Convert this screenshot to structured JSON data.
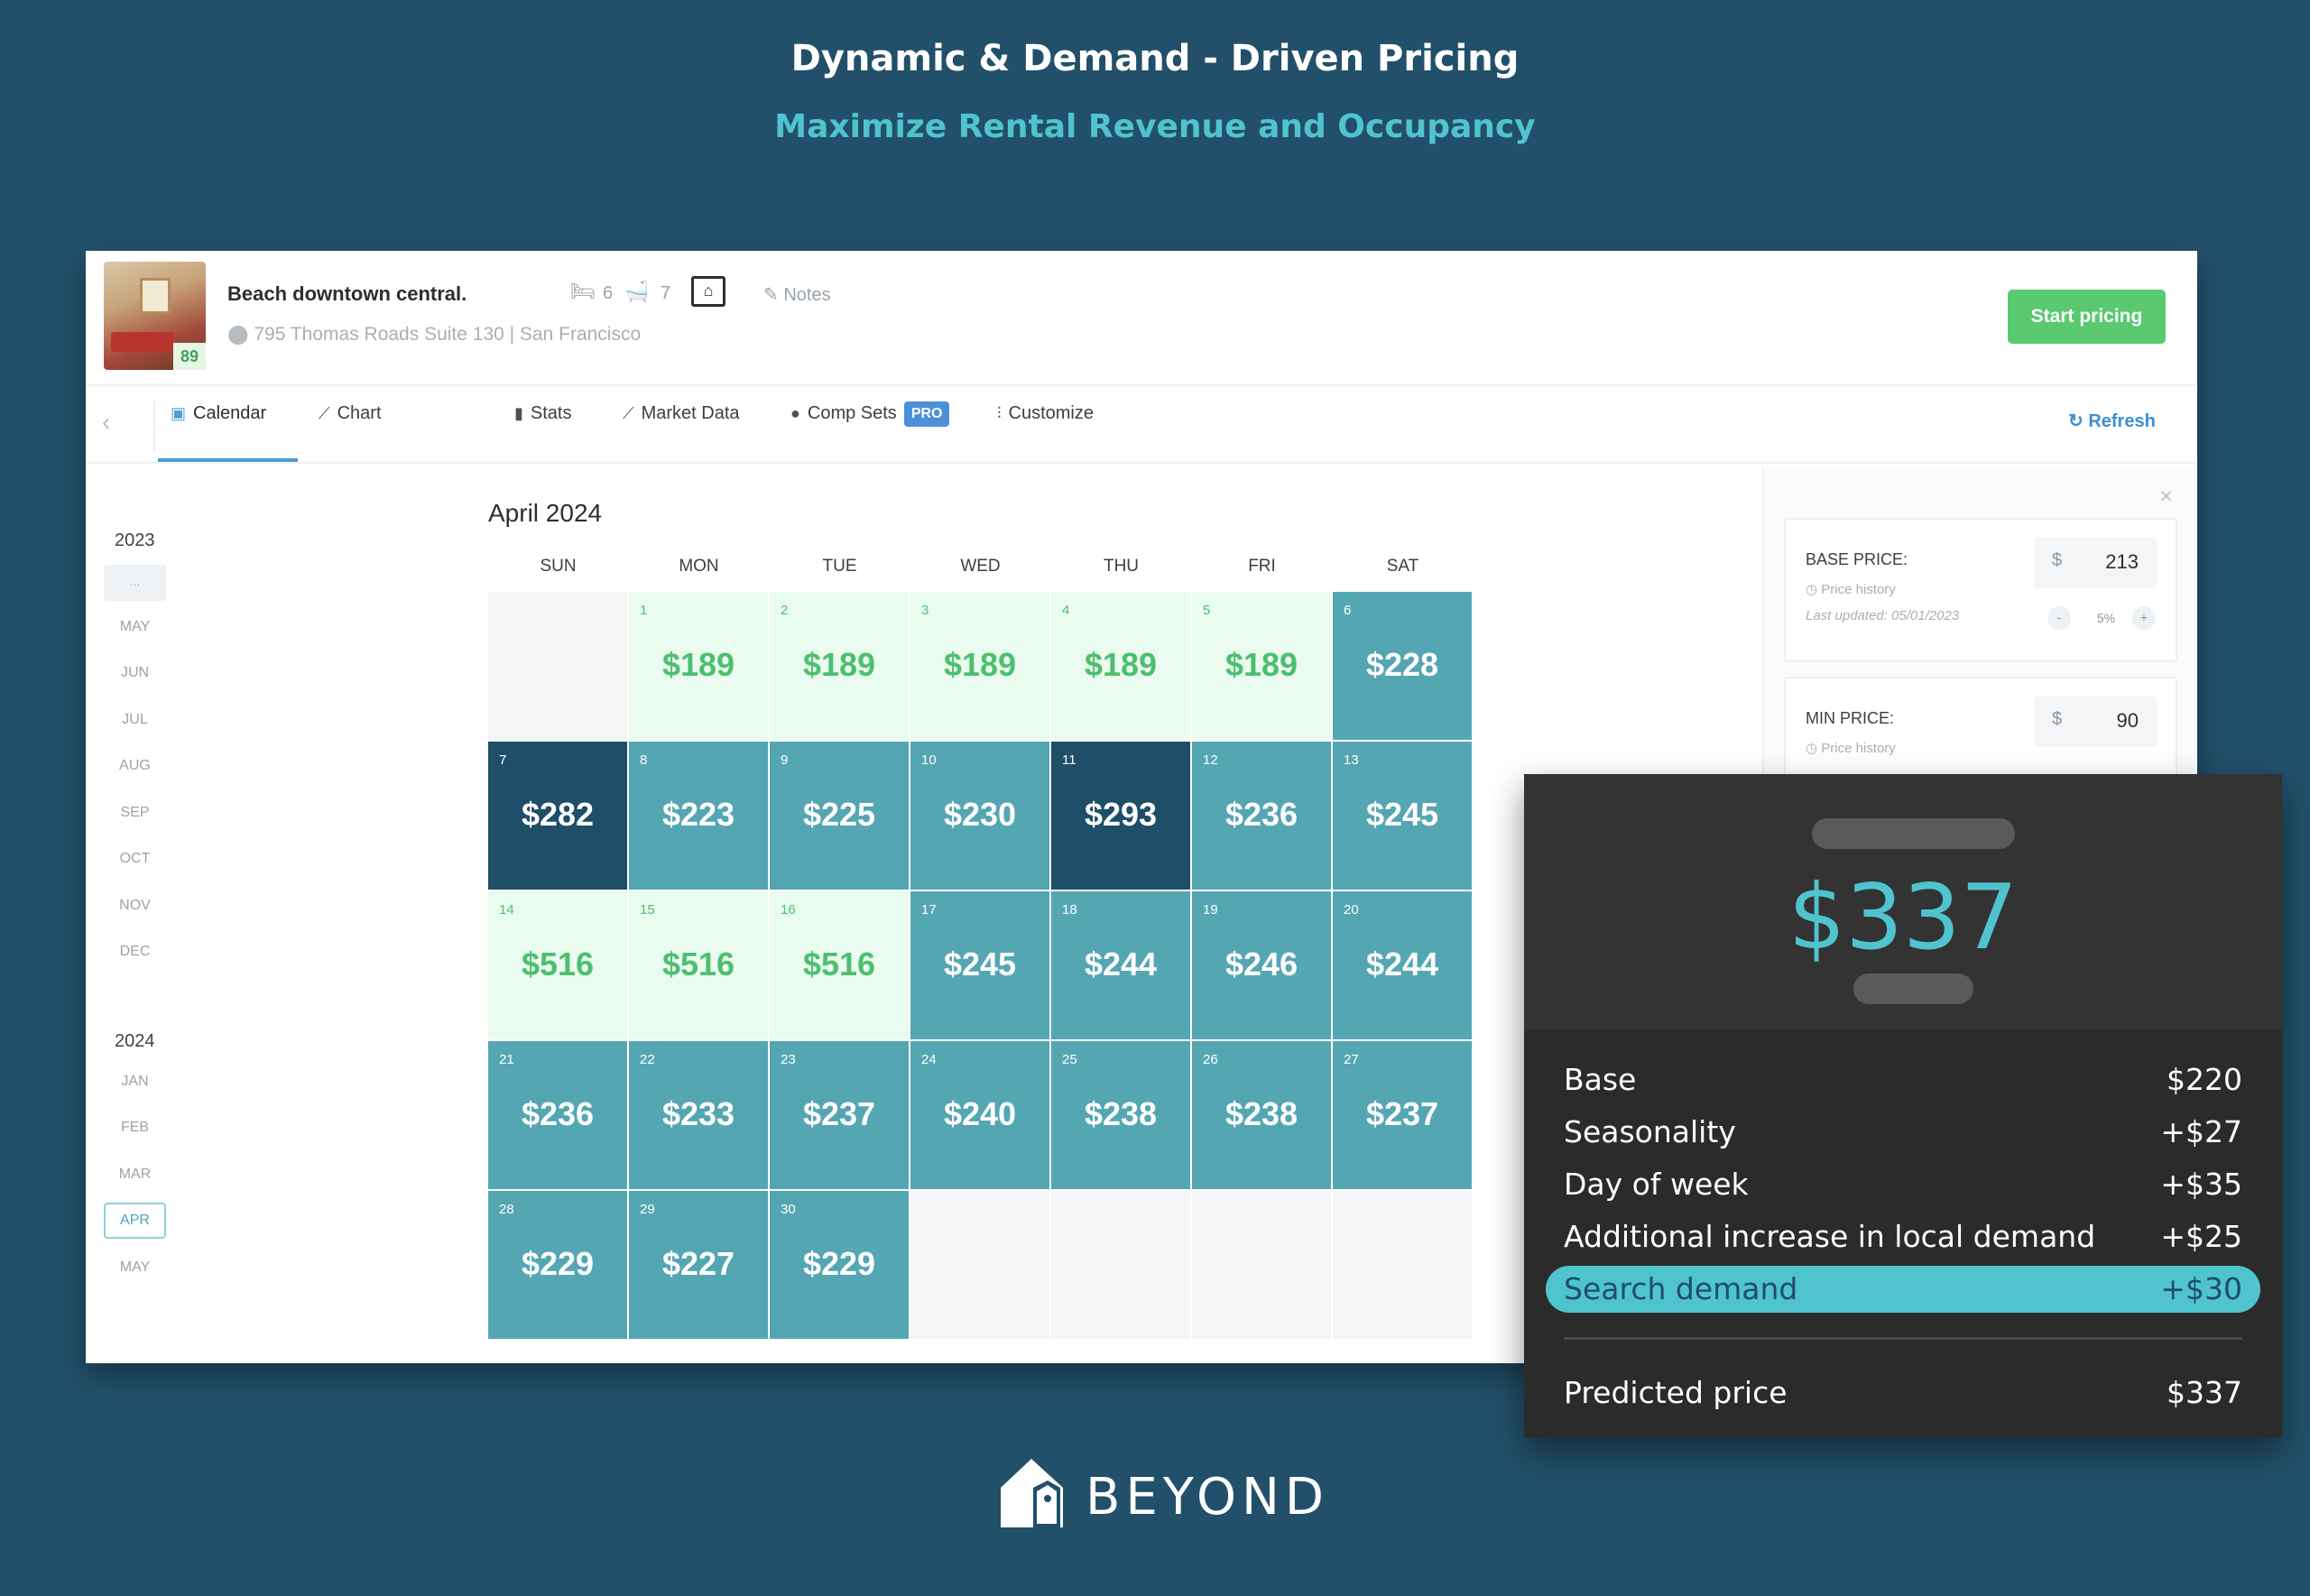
{
  "hero": {
    "title": "Dynamic & Demand - Driven Pricing",
    "subtitle": "Maximize Rental Revenue and Occupancy"
  },
  "listing": {
    "score": "89",
    "name": "Beach downtown central.",
    "bedrooms": "6",
    "bathrooms": "7",
    "notes_label": "Notes",
    "address": "795 Thomas Roads Suite 130 | San Francisco",
    "start_pricing_label": "Start pricing"
  },
  "tabs": [
    {
      "label": "Calendar",
      "icon": "calendar-icon",
      "active": true
    },
    {
      "label": "Chart",
      "icon": "line-chart-icon"
    },
    {
      "label": "Stats",
      "icon": "bar-chart-icon"
    },
    {
      "label": "Market Data",
      "icon": "area-chart-icon"
    },
    {
      "label": "Comp Sets",
      "icon": "map-pin-icon",
      "badge": "PRO"
    },
    {
      "label": "Customize",
      "icon": "sliders-icon"
    }
  ],
  "refresh_label": "Refresh",
  "year_nav": {
    "years": [
      {
        "year": "2023",
        "months": [
          "MAY",
          "JUN",
          "JUL",
          "AUG",
          "SEP",
          "OCT",
          "NOV",
          "DEC"
        ],
        "pill": "..."
      },
      {
        "year": "2024",
        "months": [
          "JAN",
          "FEB",
          "MAR",
          "APR",
          "MAY"
        ],
        "selected": "APR"
      }
    ]
  },
  "calendar": {
    "title": "April 2024",
    "weekdays": [
      "SUN",
      "MON",
      "TUE",
      "WED",
      "THU",
      "FRI",
      "SAT"
    ],
    "weeks": [
      [
        null,
        {
          "d": "1",
          "p": "$189",
          "s": "light"
        },
        {
          "d": "2",
          "p": "$189",
          "s": "light"
        },
        {
          "d": "3",
          "p": "$189",
          "s": "light"
        },
        {
          "d": "4",
          "p": "$189",
          "s": "light"
        },
        {
          "d": "5",
          "p": "$189",
          "s": "light"
        },
        {
          "d": "6",
          "p": "$228",
          "s": "mid"
        }
      ],
      [
        {
          "d": "7",
          "p": "$282",
          "s": "dark"
        },
        {
          "d": "8",
          "p": "$223",
          "s": "mid"
        },
        {
          "d": "9",
          "p": "$225",
          "s": "mid"
        },
        {
          "d": "10",
          "p": "$230",
          "s": "mid"
        },
        {
          "d": "11",
          "p": "$293",
          "s": "dark"
        },
        {
          "d": "12",
          "p": "$236",
          "s": "mid"
        },
        {
          "d": "13",
          "p": "$245",
          "s": "mid"
        }
      ],
      [
        {
          "d": "14",
          "p": "$516",
          "s": "light"
        },
        {
          "d": "15",
          "p": "$516",
          "s": "light"
        },
        {
          "d": "16",
          "p": "$516",
          "s": "light"
        },
        {
          "d": "17",
          "p": "$245",
          "s": "mid"
        },
        {
          "d": "18",
          "p": "$244",
          "s": "mid"
        },
        {
          "d": "19",
          "p": "$246",
          "s": "mid"
        },
        {
          "d": "20",
          "p": "$244",
          "s": "mid"
        }
      ],
      [
        {
          "d": "21",
          "p": "$236",
          "s": "mid"
        },
        {
          "d": "22",
          "p": "$233",
          "s": "mid"
        },
        {
          "d": "23",
          "p": "$237",
          "s": "mid"
        },
        {
          "d": "24",
          "p": "$240",
          "s": "mid"
        },
        {
          "d": "25",
          "p": "$238",
          "s": "mid"
        },
        {
          "d": "26",
          "p": "$238",
          "s": "mid"
        },
        {
          "d": "27",
          "p": "$237",
          "s": "mid"
        }
      ],
      [
        {
          "d": "28",
          "p": "$229",
          "s": "mid"
        },
        {
          "d": "29",
          "p": "$227",
          "s": "mid"
        },
        {
          "d": "30",
          "p": "$229",
          "s": "mid"
        },
        null,
        null,
        null,
        null
      ]
    ]
  },
  "side_panel": {
    "base": {
      "label": "BASE PRICE:",
      "history": "Price history",
      "updated": "Last updated: 05/01/2023",
      "currency": "$",
      "value": "213",
      "minus": "-",
      "pct": "5%",
      "plus": "+"
    },
    "min": {
      "label": "MIN PRICE:",
      "history": "Price history",
      "currency": "$",
      "value": "90"
    }
  },
  "breakdown": {
    "price": "$337",
    "rows": [
      {
        "label": "Base",
        "amount": "$220"
      },
      {
        "label": "Seasonality",
        "amount": "+$27"
      },
      {
        "label": "Day of week",
        "amount": "+$35"
      },
      {
        "label": "Additional increase in local demand",
        "amount": "+$25"
      },
      {
        "label": "Search demand",
        "amount": "+$30",
        "highlight": true
      }
    ],
    "total_label": "Predicted price",
    "total_amount": "$337"
  },
  "brand": {
    "name": "BEYOND"
  },
  "colors": {
    "background": "#22506a",
    "accent": "#4fc4cf",
    "start_button": "#5ac96f",
    "cell_light": "#eafbef",
    "cell_mid": "#55a6b3",
    "cell_dark": "#1e4e68"
  }
}
